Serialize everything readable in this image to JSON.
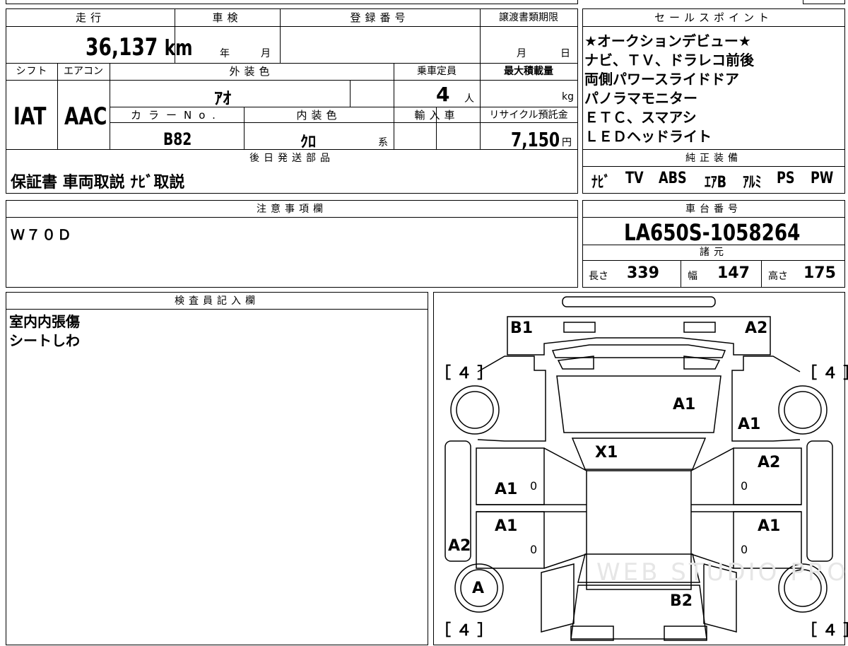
{
  "mileage": {
    "label": "走行",
    "value": "36,137",
    "unit": "km"
  },
  "inspection": {
    "label": "車検",
    "year_unit": "年",
    "month_unit": "月"
  },
  "registration": {
    "label": "登録番号"
  },
  "transfer_deadline": {
    "label": "譲渡書類期限",
    "month_unit": "月",
    "day_unit": "日"
  },
  "shift": {
    "label": "シフト",
    "value": "IAT"
  },
  "aircon": {
    "label": "エアコン",
    "value": "AAC"
  },
  "exterior_color": {
    "label": "外装色",
    "value": "ｱｵ"
  },
  "capacity": {
    "label": "乗車定員",
    "value": "4",
    "unit": "人"
  },
  "max_load": {
    "label": "最大積載量",
    "unit": "kg"
  },
  "color_no": {
    "label": "カラーNo.",
    "value": "B82"
  },
  "interior_color": {
    "label": "内装色",
    "value": "ｸﾛ",
    "unit": "系"
  },
  "import": {
    "label": "輸入車"
  },
  "recycle_fee": {
    "label": "リサイクル預託金",
    "value": "7,150",
    "unit": "円"
  },
  "later_parts": {
    "label": "後日発送部品",
    "value": "保証書 車両取説 ﾅﾋﾞ取説"
  },
  "sales_points": {
    "label": "セールスポイント",
    "lines": [
      "★オークションデビュー★",
      "ナビ、ＴＶ、ドラレコ前後",
      "両側パワースライドドア",
      "パノラマモニター",
      "ＥＴＣ、スマアシ",
      "ＬＥＤヘッドライト"
    ]
  },
  "genuine_equipment": {
    "label": "純正装備",
    "items": [
      "ﾅﾋﾞ",
      "TV",
      "ABS",
      "ｴｱB",
      "ｱﾙﾐ",
      "PS",
      "PW"
    ]
  },
  "notes": {
    "label": "注意事項欄",
    "value": "Ｗ７０Ｄ"
  },
  "chassis": {
    "label": "車台番号",
    "value": "LA650S-1058264"
  },
  "specs": {
    "label": "諸元",
    "length_label": "長さ",
    "length": "339",
    "width_label": "幅",
    "width": "147",
    "height_label": "高さ",
    "height": "175"
  },
  "inspector": {
    "label": "検査員記入欄",
    "lines": [
      "室内内張傷",
      "シートしわ"
    ]
  },
  "diagram": {
    "marks": {
      "front_left": "B1",
      "front_right": "A2",
      "hood": "A1",
      "right_fender": "A1",
      "windshield": "X1",
      "right_front_door": "A2",
      "left_front_door": "A1",
      "left_rear_door": "A1",
      "right_rear_door": "A1",
      "left_rear_quarter": "A2",
      "left_rear_wheel": "A",
      "roof_rear": "B2"
    },
    "tire_top_left": "［ ４ ］",
    "tire_top_right": "［ ４ ］",
    "tire_bottom_left": "［ ４ ］",
    "tire_bottom_right": "［ ４ ］",
    "zero": "0",
    "watermark": "WEB STUDIO PRO"
  }
}
